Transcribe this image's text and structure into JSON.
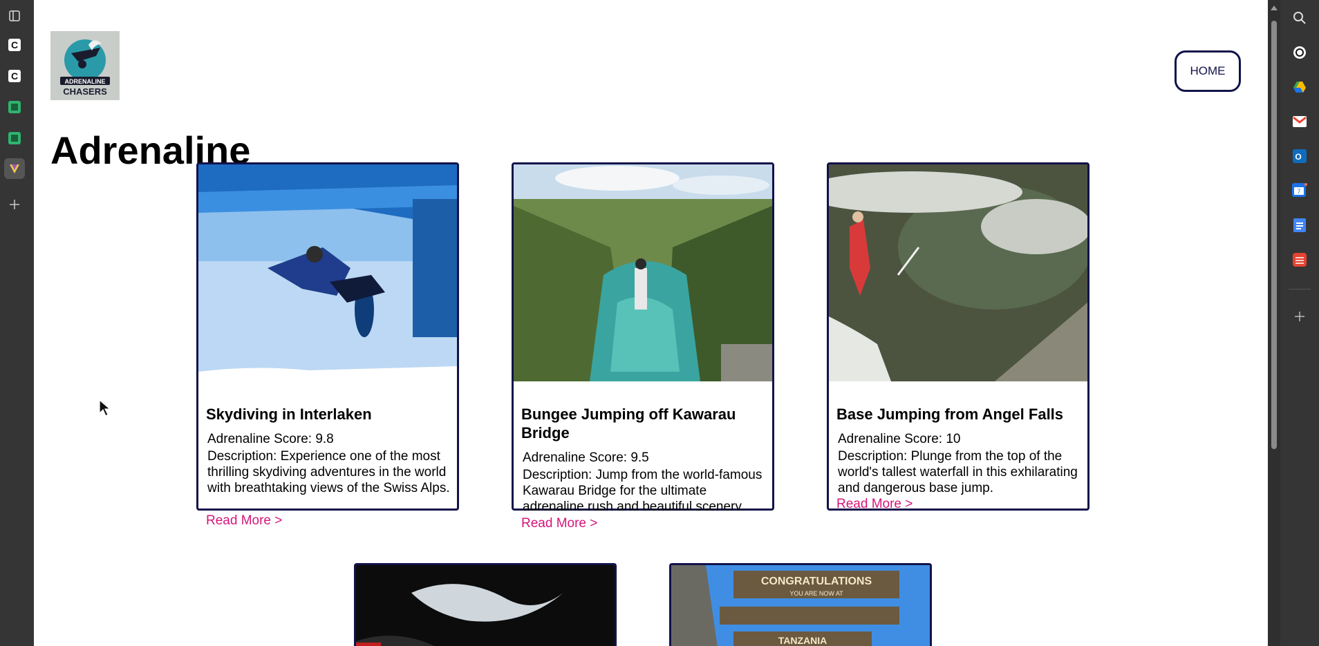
{
  "site": {
    "logo_alt": "Adrenaline Chasers",
    "logo_text_top": "ADRENALINE",
    "logo_text_bottom": "CHASERS",
    "home_label": "HOME",
    "page_title": "Adrenaline"
  },
  "cards": [
    {
      "title": "Skydiving in Interlaken",
      "score": "Adrenaline Score: 9.8",
      "description": "Description: Experience one of the most thrilling skydiving adventures in the world with breathtaking views of the Swiss Alps.",
      "link": "Read More >"
    },
    {
      "title": "Bungee Jumping off Kawarau Bridge",
      "score": "Adrenaline Score: 9.5",
      "description": "Description: Jump from the world-famous Kawarau Bridge for the ultimate adrenaline rush and beautiful scenery.",
      "link": "Read More >"
    },
    {
      "title": "Base Jumping from Angel Falls",
      "score": "Adrenaline Score: 10",
      "description": "Description: Plunge from the top of the world's tallest waterfall in this exhilarating and dangerous base jump.",
      "link": "Read More >"
    }
  ],
  "sign_text": {
    "line1": "CONGRATULATIONS",
    "line2": "YOU ARE NOW AT",
    "line3": "TANZANIA"
  },
  "colors": {
    "card_border": "#12124a",
    "link": "#d6157a",
    "home_border": "#12124a"
  },
  "left_rail_icons": [
    "panel-icon",
    "c-app-icon",
    "c-app-icon",
    "green-app-icon",
    "green-app-icon",
    "arc-app-icon",
    "plus-icon"
  ],
  "right_rail_icons": [
    "search-icon",
    "chatgpt-icon",
    "drive-icon",
    "gmail-icon",
    "outlook-icon",
    "calendar-icon",
    "docs-icon",
    "todoist-icon",
    "plus-icon"
  ]
}
